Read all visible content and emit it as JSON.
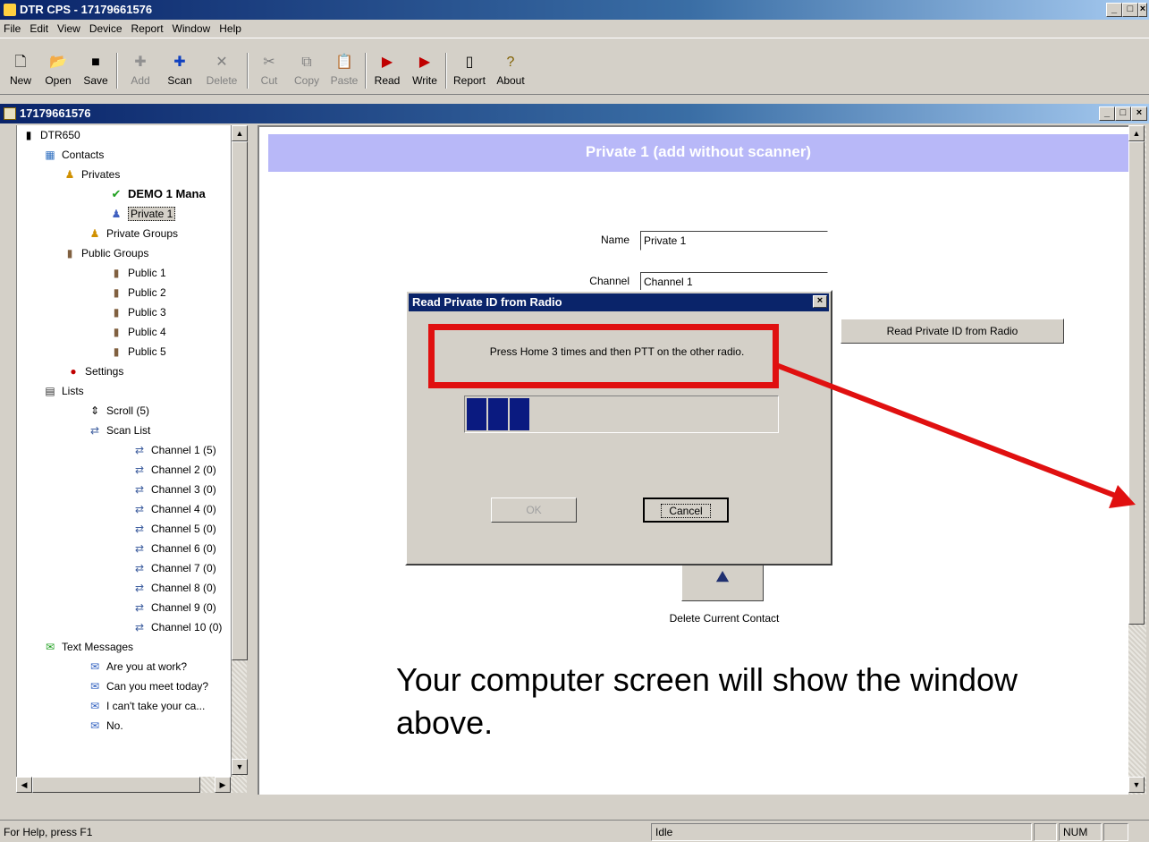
{
  "window": {
    "title": "DTR CPS - 17179661576",
    "child_title": "17179661576"
  },
  "menu": [
    "File",
    "Edit",
    "View",
    "Device",
    "Report",
    "Window",
    "Help"
  ],
  "toolbar": {
    "new": "New",
    "open": "Open",
    "save": "Save",
    "add": "Add",
    "scan": "Scan",
    "delete": "Delete",
    "cut": "Cut",
    "copy": "Copy",
    "paste": "Paste",
    "read": "Read",
    "write": "Write",
    "report": "Report",
    "about": "About"
  },
  "tree": {
    "root": "DTR650",
    "contacts": "Contacts",
    "privates": "Privates",
    "demo": "DEMO 1 Mana",
    "private1": "Private 1",
    "private_groups": "Private Groups",
    "public_groups": "Public Groups",
    "public": [
      "Public 1",
      "Public 2",
      "Public 3",
      "Public 4",
      "Public 5"
    ],
    "settings": "Settings",
    "lists": "Lists",
    "scroll": "Scroll (5)",
    "scan_list": "Scan List",
    "channels": [
      "Channel 1 (5)",
      "Channel 2 (0)",
      "Channel 3 (0)",
      "Channel 4 (0)",
      "Channel 5 (0)",
      "Channel 6 (0)",
      "Channel 7 (0)",
      "Channel 8 (0)",
      "Channel 9 (0)",
      "Channel 10 (0)"
    ],
    "text_messages": "Text Messages",
    "messages": [
      "Are you at work?",
      "Can you meet today?",
      "I can't take your ca...",
      "No."
    ]
  },
  "form": {
    "header": "Private 1 (add without scanner)",
    "name_label": "Name",
    "name_value": "Private 1",
    "channel_label": "Channel",
    "channel_value": "Channel 1",
    "read_button": "Read Private ID from Radio",
    "delete_label": "Delete Current Contact"
  },
  "dialog": {
    "title": "Read Private ID from Radio",
    "message": "Press Home 3 times and then PTT on the other radio.",
    "progress": 0.22,
    "ok": "OK",
    "cancel": "Cancel"
  },
  "caption": "Your computer screen will show the window above.",
  "status": {
    "help": "For Help, press F1",
    "state": "Idle",
    "num": "NUM"
  },
  "colors": {
    "accent_red": "#e01010",
    "header_bg": "#b8b8f8",
    "progress": "#0a1a80"
  }
}
